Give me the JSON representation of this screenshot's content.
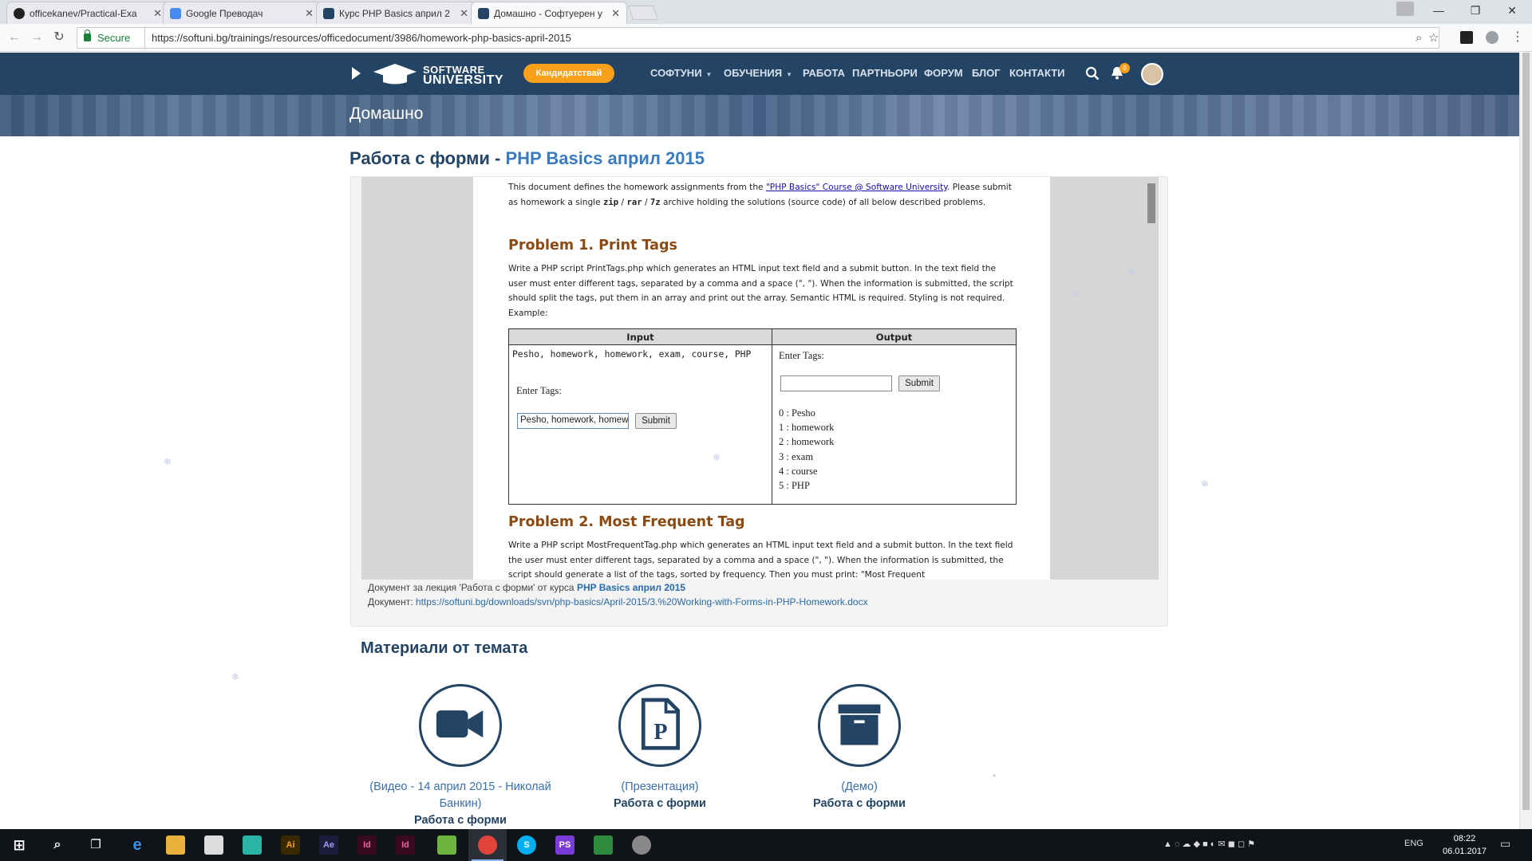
{
  "browser": {
    "tabs": [
      {
        "title": "officekanev/Practical-Exa",
        "active": false
      },
      {
        "title": "Google Преводач",
        "active": false
      },
      {
        "title": "Курс PHP Basics април 2",
        "active": false
      },
      {
        "title": "Домашно - Софтуерен у",
        "active": true
      }
    ],
    "secure_label": "Secure",
    "url": "https://softuni.bg/trainings/resources/officedocument/3986/homework-php-basics-april-2015"
  },
  "site": {
    "logo_line1": "SOFTWARE",
    "logo_line2": "UNIVERSITY",
    "apply_label": "Кандидатствай",
    "menu": [
      "СОФТУНИ",
      "ОБУЧЕНИЯ",
      "РАБОТА",
      "ПАРТНЬОРИ",
      "ФОРУМ",
      "БЛОГ",
      "КОНТАКТИ"
    ],
    "notifications": "0",
    "banner_title": "Домашно",
    "page_title_prefix": "Работа с форми - ",
    "page_title_course": "PHP Basics април 2015"
  },
  "document": {
    "intro_before": "This document defines the homework assignments from the ",
    "intro_link": "\"PHP Basics\" Course @ Software University",
    "intro_after1": ". Please submit as homework a single ",
    "intro_zip": "zip",
    "intro_slash": " / ",
    "intro_rar": "rar",
    "intro_7z": "7z",
    "intro_after2": " archive holding the solutions (source code) of all below described problems.",
    "problem1_title": "Problem 1.   Print Tags",
    "problem1_text": "Write a PHP script PrintTags.php which generates an HTML input text field and a submit button. In the text field the user must enter different tags, separated by a comma and a space (\", \"). When the information is submitted, the script should split the tags, put them in an array and print out the array. Semantic HTML is required. Styling is not required. Example:",
    "table_input_header": "Input",
    "table_output_header": "Output",
    "input_code": "Pesho, homework, homework, exam, course, PHP",
    "enter_tags": "Enter Tags:",
    "input_field_value": "Pesho, homework, homew",
    "submit_label": "Submit",
    "output_items": [
      "0 : Pesho",
      "1 : homework",
      "2 : homework",
      "3 : exam",
      "4 : course",
      "5 : PHP"
    ],
    "problem2_title": "Problem 2.   Most Frequent Tag",
    "problem2_text": "Write a PHP script MostFrequentTag.php which generates an HTML input text field and a submit button. In the text field the user must enter different tags, separated by a comma and a space (\", \"). When the information is submitted, the script should generate a list of the tags, sorted by frequency. Then you must print: \"Most Frequent",
    "caption_prefix": "Документ за лекция 'Работа с форми' от курса ",
    "caption_course": "PHP Basics април 2015",
    "caption_doc_label": "Документ: ",
    "caption_doc_url": "https://softuni.bg/downloads/svn/php-basics/April-2015/3.%20Working-with-Forms-in-PHP-Homework.docx"
  },
  "materials": {
    "title": "Материали от темата",
    "items": [
      {
        "icon": "video-camera-icon",
        "label": "(Видео - 14 април 2015 - Николай Банкин)",
        "name": "Работа с форми"
      },
      {
        "icon": "presentation-icon",
        "label": "(Презентация)",
        "name": "Работа с форми"
      },
      {
        "icon": "archive-box-icon",
        "label": "(Демо)",
        "name": "Работа с форми"
      }
    ]
  },
  "taskbar": {
    "language": "ENG",
    "time": "08:22",
    "date": "06.01.2017"
  },
  "colors": {
    "nav_bg": "#234465",
    "accent_orange": "#f7a11a",
    "link_blue": "#3a7bbf",
    "problem_heading": "#8a4a12"
  }
}
